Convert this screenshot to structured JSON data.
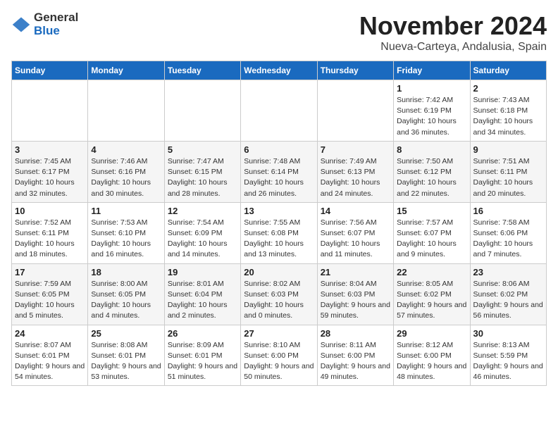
{
  "logo": {
    "general": "General",
    "blue": "Blue"
  },
  "title": {
    "month": "November 2024",
    "location": "Nueva-Carteya, Andalusia, Spain"
  },
  "headers": [
    "Sunday",
    "Monday",
    "Tuesday",
    "Wednesday",
    "Thursday",
    "Friday",
    "Saturday"
  ],
  "weeks": [
    [
      {
        "day": "",
        "info": ""
      },
      {
        "day": "",
        "info": ""
      },
      {
        "day": "",
        "info": ""
      },
      {
        "day": "",
        "info": ""
      },
      {
        "day": "",
        "info": ""
      },
      {
        "day": "1",
        "info": "Sunrise: 7:42 AM\nSunset: 6:19 PM\nDaylight: 10 hours and 36 minutes."
      },
      {
        "day": "2",
        "info": "Sunrise: 7:43 AM\nSunset: 6:18 PM\nDaylight: 10 hours and 34 minutes."
      }
    ],
    [
      {
        "day": "3",
        "info": "Sunrise: 7:45 AM\nSunset: 6:17 PM\nDaylight: 10 hours and 32 minutes."
      },
      {
        "day": "4",
        "info": "Sunrise: 7:46 AM\nSunset: 6:16 PM\nDaylight: 10 hours and 30 minutes."
      },
      {
        "day": "5",
        "info": "Sunrise: 7:47 AM\nSunset: 6:15 PM\nDaylight: 10 hours and 28 minutes."
      },
      {
        "day": "6",
        "info": "Sunrise: 7:48 AM\nSunset: 6:14 PM\nDaylight: 10 hours and 26 minutes."
      },
      {
        "day": "7",
        "info": "Sunrise: 7:49 AM\nSunset: 6:13 PM\nDaylight: 10 hours and 24 minutes."
      },
      {
        "day": "8",
        "info": "Sunrise: 7:50 AM\nSunset: 6:12 PM\nDaylight: 10 hours and 22 minutes."
      },
      {
        "day": "9",
        "info": "Sunrise: 7:51 AM\nSunset: 6:11 PM\nDaylight: 10 hours and 20 minutes."
      }
    ],
    [
      {
        "day": "10",
        "info": "Sunrise: 7:52 AM\nSunset: 6:11 PM\nDaylight: 10 hours and 18 minutes."
      },
      {
        "day": "11",
        "info": "Sunrise: 7:53 AM\nSunset: 6:10 PM\nDaylight: 10 hours and 16 minutes."
      },
      {
        "day": "12",
        "info": "Sunrise: 7:54 AM\nSunset: 6:09 PM\nDaylight: 10 hours and 14 minutes."
      },
      {
        "day": "13",
        "info": "Sunrise: 7:55 AM\nSunset: 6:08 PM\nDaylight: 10 hours and 13 minutes."
      },
      {
        "day": "14",
        "info": "Sunrise: 7:56 AM\nSunset: 6:07 PM\nDaylight: 10 hours and 11 minutes."
      },
      {
        "day": "15",
        "info": "Sunrise: 7:57 AM\nSunset: 6:07 PM\nDaylight: 10 hours and 9 minutes."
      },
      {
        "day": "16",
        "info": "Sunrise: 7:58 AM\nSunset: 6:06 PM\nDaylight: 10 hours and 7 minutes."
      }
    ],
    [
      {
        "day": "17",
        "info": "Sunrise: 7:59 AM\nSunset: 6:05 PM\nDaylight: 10 hours and 5 minutes."
      },
      {
        "day": "18",
        "info": "Sunrise: 8:00 AM\nSunset: 6:05 PM\nDaylight: 10 hours and 4 minutes."
      },
      {
        "day": "19",
        "info": "Sunrise: 8:01 AM\nSunset: 6:04 PM\nDaylight: 10 hours and 2 minutes."
      },
      {
        "day": "20",
        "info": "Sunrise: 8:02 AM\nSunset: 6:03 PM\nDaylight: 10 hours and 0 minutes."
      },
      {
        "day": "21",
        "info": "Sunrise: 8:04 AM\nSunset: 6:03 PM\nDaylight: 9 hours and 59 minutes."
      },
      {
        "day": "22",
        "info": "Sunrise: 8:05 AM\nSunset: 6:02 PM\nDaylight: 9 hours and 57 minutes."
      },
      {
        "day": "23",
        "info": "Sunrise: 8:06 AM\nSunset: 6:02 PM\nDaylight: 9 hours and 56 minutes."
      }
    ],
    [
      {
        "day": "24",
        "info": "Sunrise: 8:07 AM\nSunset: 6:01 PM\nDaylight: 9 hours and 54 minutes."
      },
      {
        "day": "25",
        "info": "Sunrise: 8:08 AM\nSunset: 6:01 PM\nDaylight: 9 hours and 53 minutes."
      },
      {
        "day": "26",
        "info": "Sunrise: 8:09 AM\nSunset: 6:01 PM\nDaylight: 9 hours and 51 minutes."
      },
      {
        "day": "27",
        "info": "Sunrise: 8:10 AM\nSunset: 6:00 PM\nDaylight: 9 hours and 50 minutes."
      },
      {
        "day": "28",
        "info": "Sunrise: 8:11 AM\nSunset: 6:00 PM\nDaylight: 9 hours and 49 minutes."
      },
      {
        "day": "29",
        "info": "Sunrise: 8:12 AM\nSunset: 6:00 PM\nDaylight: 9 hours and 48 minutes."
      },
      {
        "day": "30",
        "info": "Sunrise: 8:13 AM\nSunset: 5:59 PM\nDaylight: 9 hours and 46 minutes."
      }
    ]
  ]
}
